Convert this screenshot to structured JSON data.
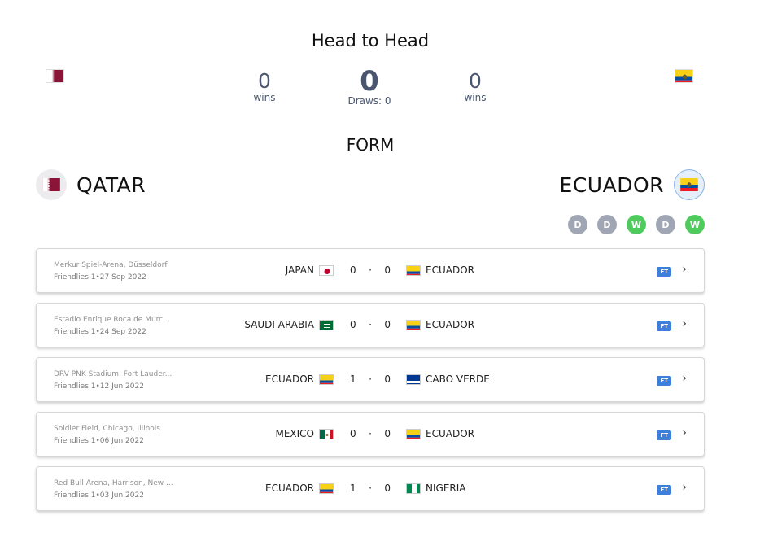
{
  "head_to_head": {
    "title": "Head to Head",
    "home_wins": "0",
    "home_wins_label": "wins",
    "draws_total": "0",
    "draws_label": "Draws: 0",
    "away_wins": "0",
    "away_wins_label": "wins"
  },
  "form": {
    "title": "FORM",
    "home_team": "QATAR",
    "away_team": "ECUADOR",
    "away_results": [
      "D",
      "D",
      "W",
      "D",
      "W"
    ]
  },
  "matches": [
    {
      "venue": "Merkur Spiel-Arena, Düsseldorf",
      "meta": "Friendlies 1•27 Sep 2022",
      "home": "JAPAN",
      "home_flag": "japan-flag-icon",
      "home_score": "0",
      "sep": "·",
      "away_score": "0",
      "away": "ECUADOR",
      "away_flag": "ecuador-flag-icon",
      "status": "FT"
    },
    {
      "venue": "Estadio Enrique Roca de Murc...",
      "meta": "Friendlies 1•24 Sep 2022",
      "home": "SAUDI ARABIA",
      "home_flag": "saudi-arabia-flag-icon",
      "home_score": "0",
      "sep": "·",
      "away_score": "0",
      "away": "ECUADOR",
      "away_flag": "ecuador-flag-icon",
      "status": "FT"
    },
    {
      "venue": "DRV PNK Stadium, Fort Lauder...",
      "meta": "Friendlies 1•12 Jun 2022",
      "home": "ECUADOR",
      "home_flag": "ecuador-flag-icon",
      "home_score": "1",
      "sep": "·",
      "away_score": "0",
      "away": "CABO VERDE",
      "away_flag": "cabo-verde-flag-icon",
      "status": "FT"
    },
    {
      "venue": "Soldier Field, Chicago, Illinois",
      "meta": "Friendlies 1•06 Jun 2022",
      "home": "MEXICO",
      "home_flag": "mexico-flag-icon",
      "home_score": "0",
      "sep": "·",
      "away_score": "0",
      "away": "ECUADOR",
      "away_flag": "ecuador-flag-icon",
      "status": "FT"
    },
    {
      "venue": "Red Bull Arena, Harrison, New ...",
      "meta": "Friendlies 1•03 Jun 2022",
      "home": "ECUADOR",
      "home_flag": "ecuador-flag-icon",
      "home_score": "1",
      "sep": "·",
      "away_score": "0",
      "away": "NIGERIA",
      "away_flag": "nigeria-flag-icon",
      "status": "FT"
    }
  ],
  "colors": {
    "draw_badge": "#a0a6b4",
    "win_badge": "#4fcb5e",
    "ft_badge": "#3d7fdb",
    "stat_text": "#4a5670"
  }
}
